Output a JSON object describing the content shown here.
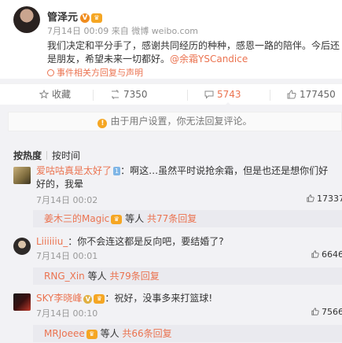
{
  "post": {
    "username": "管泽元",
    "date": "7月14日",
    "source": "00:09 来自 微博 weibo.com",
    "content_line1": "我们决定和平分手了，感谢共同经历的种种，感恩一路的陪伴。今后还",
    "content_line2_prefix": "是朋友，希望未来一切都好。",
    "mention": "@余霜YSCandice",
    "event_link": "事件相关方回复与声明"
  },
  "actions": {
    "favorite": "收藏",
    "repost": "7350",
    "comment": "5743",
    "like": "177450"
  },
  "notice": "由于用户设置，你无法回复评论。",
  "sort": {
    "hot": "按热度",
    "time": "按时间"
  },
  "comments": [
    {
      "name": "爱咕咕真是太好了",
      "level": "1",
      "text_line1": "：啊这…虽然平时说抢余霜，但是也还是想你们好",
      "text_line2": "好的，我晕",
      "time": "7月14日 00:02",
      "likes": "17337",
      "reply_name": "姜木三的Magic",
      "reply_suffix": "等人",
      "reply_count": "共77条回复"
    },
    {
      "name": "Liiiiiiu_",
      "text_line1": "：你不会连这都是反向吧，要结婚了?",
      "time": "7月14日 00:01",
      "likes": "6646",
      "reply_name": "RNG_Xin",
      "reply_suffix": "等人",
      "reply_count": "共79条回复"
    },
    {
      "name": "SKY李晓峰",
      "text_line1": "：祝好，没事多来打篮球!",
      "time": "7月14日 00:10",
      "likes": "7566",
      "reply_name": "MRJoeee",
      "reply_suffix": "等人",
      "reply_count": "共66条回复"
    }
  ],
  "colors": {
    "accent": "#eb7350",
    "background": "#f2f2f5",
    "muted": "#999999"
  }
}
